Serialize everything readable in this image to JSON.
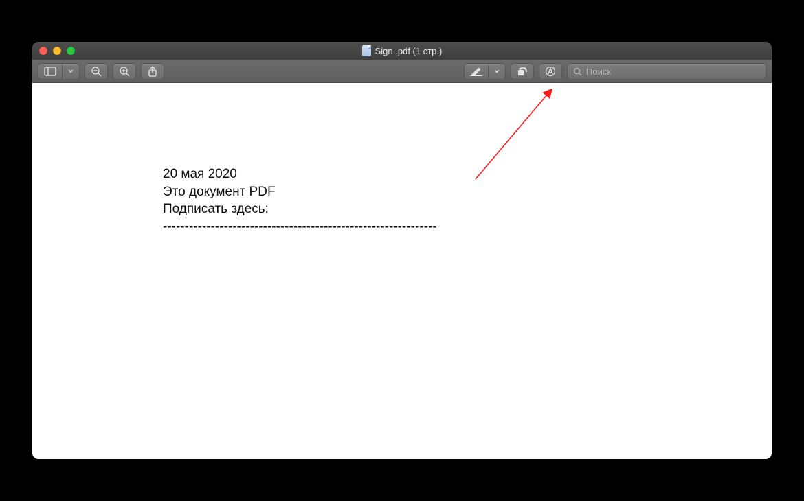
{
  "window": {
    "title": "Sign .pdf (1 стр.)"
  },
  "toolbar": {
    "sidebar_tooltip": "Sidebar",
    "zoom_out_tooltip": "Zoom Out",
    "zoom_in_tooltip": "Zoom In",
    "share_tooltip": "Share",
    "highlight_tooltip": "Highlight",
    "rotate_tooltip": "Rotate",
    "markup_tooltip": "Markup"
  },
  "search": {
    "placeholder": "Поиск"
  },
  "document": {
    "line1": "20 мая 2020",
    "line2": "Это документ PDF",
    "line3": "Подписать здесь:",
    "signature_line": "---------------------------------------------------------------"
  }
}
